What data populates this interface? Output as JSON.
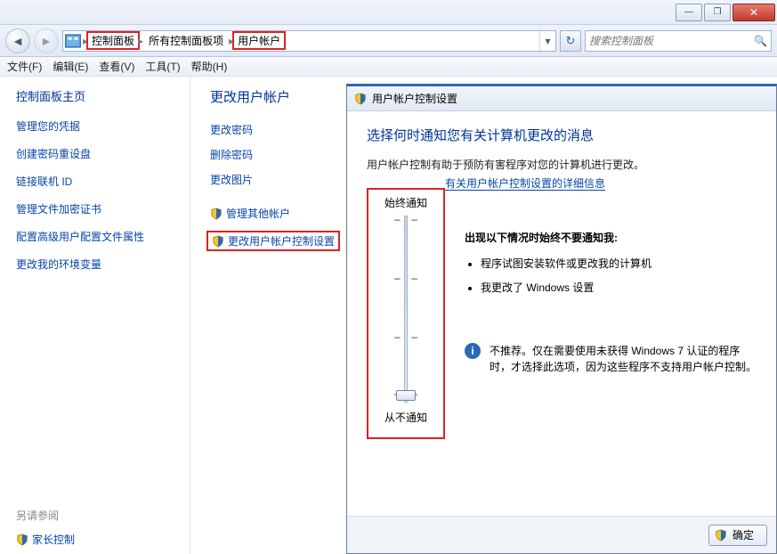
{
  "titlebar": {
    "min": "—",
    "max": "❐",
    "close": "✕"
  },
  "nav": {
    "crumbs": [
      "控制面板",
      "所有控制面板项",
      "用户帐户"
    ],
    "search_placeholder": "搜索控制面板"
  },
  "menu": [
    "文件(F)",
    "编辑(E)",
    "查看(V)",
    "工具(T)",
    "帮助(H)"
  ],
  "sidebar": {
    "heading": "控制面板主页",
    "links": [
      "管理您的凭据",
      "创建密码重设盘",
      "链接联机 ID",
      "管理文件加密证书",
      "配置高级用户配置文件属性",
      "更改我的环境变量"
    ],
    "see_also": "另请参阅",
    "parental": "家长控制"
  },
  "main": {
    "heading": "更改用户帐户",
    "links": [
      "更改密码",
      "删除密码",
      "更改图片"
    ],
    "shield_links": [
      "管理其他帐户",
      "更改用户帐户控制设置"
    ]
  },
  "modal": {
    "title": "用户帐户控制设置",
    "h2": "选择何时通知您有关计算机更改的消息",
    "desc": "用户帐户控制有助于预防有害程序对您的计算机进行更改。",
    "more": "有关用户帐户控制设置的详细信息",
    "top_label": "始终通知",
    "bottom_label": "从不通知",
    "right_title": "出现以下情况时始终不要通知我:",
    "bullets": [
      "程序试图安装软件或更改我的计算机",
      "我更改了 Windows 设置"
    ],
    "info": "不推荐。仅在需要使用未获得 Windows 7 认证的程序时，才选择此选项，因为这些程序不支持用户帐户控制。",
    "ok": "确定"
  }
}
